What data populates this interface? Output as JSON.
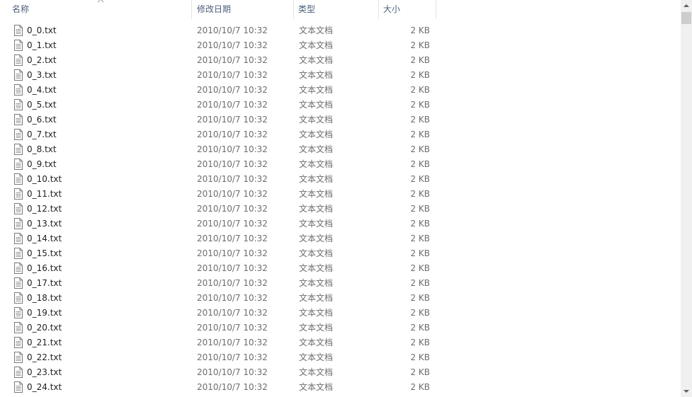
{
  "columns": {
    "name": "名称",
    "date_modified": "修改日期",
    "type": "类型",
    "size": "大小"
  },
  "sort": {
    "column": "name",
    "direction": "ascending",
    "icon": "sort-up-icon"
  },
  "files": [
    {
      "name": "0_0.txt",
      "date": "2010/10/7 10:32",
      "type": "文本文档",
      "size": "2 KB"
    },
    {
      "name": "0_1.txt",
      "date": "2010/10/7 10:32",
      "type": "文本文档",
      "size": "2 KB"
    },
    {
      "name": "0_2.txt",
      "date": "2010/10/7 10:32",
      "type": "文本文档",
      "size": "2 KB"
    },
    {
      "name": "0_3.txt",
      "date": "2010/10/7 10:32",
      "type": "文本文档",
      "size": "2 KB"
    },
    {
      "name": "0_4.txt",
      "date": "2010/10/7 10:32",
      "type": "文本文档",
      "size": "2 KB"
    },
    {
      "name": "0_5.txt",
      "date": "2010/10/7 10:32",
      "type": "文本文档",
      "size": "2 KB"
    },
    {
      "name": "0_6.txt",
      "date": "2010/10/7 10:32",
      "type": "文本文档",
      "size": "2 KB"
    },
    {
      "name": "0_7.txt",
      "date": "2010/10/7 10:32",
      "type": "文本文档",
      "size": "2 KB"
    },
    {
      "name": "0_8.txt",
      "date": "2010/10/7 10:32",
      "type": "文本文档",
      "size": "2 KB"
    },
    {
      "name": "0_9.txt",
      "date": "2010/10/7 10:32",
      "type": "文本文档",
      "size": "2 KB"
    },
    {
      "name": "0_10.txt",
      "date": "2010/10/7 10:32",
      "type": "文本文档",
      "size": "2 KB"
    },
    {
      "name": "0_11.txt",
      "date": "2010/10/7 10:32",
      "type": "文本文档",
      "size": "2 KB"
    },
    {
      "name": "0_12.txt",
      "date": "2010/10/7 10:32",
      "type": "文本文档",
      "size": "2 KB"
    },
    {
      "name": "0_13.txt",
      "date": "2010/10/7 10:32",
      "type": "文本文档",
      "size": "2 KB"
    },
    {
      "name": "0_14.txt",
      "date": "2010/10/7 10:32",
      "type": "文本文档",
      "size": "2 KB"
    },
    {
      "name": "0_15.txt",
      "date": "2010/10/7 10:32",
      "type": "文本文档",
      "size": "2 KB"
    },
    {
      "name": "0_16.txt",
      "date": "2010/10/7 10:32",
      "type": "文本文档",
      "size": "2 KB"
    },
    {
      "name": "0_17.txt",
      "date": "2010/10/7 10:32",
      "type": "文本文档",
      "size": "2 KB"
    },
    {
      "name": "0_18.txt",
      "date": "2010/10/7 10:32",
      "type": "文本文档",
      "size": "2 KB"
    },
    {
      "name": "0_19.txt",
      "date": "2010/10/7 10:32",
      "type": "文本文档",
      "size": "2 KB"
    },
    {
      "name": "0_20.txt",
      "date": "2010/10/7 10:32",
      "type": "文本文档",
      "size": "2 KB"
    },
    {
      "name": "0_21.txt",
      "date": "2010/10/7 10:32",
      "type": "文本文档",
      "size": "2 KB"
    },
    {
      "name": "0_22.txt",
      "date": "2010/10/7 10:32",
      "type": "文本文档",
      "size": "2 KB"
    },
    {
      "name": "0_23.txt",
      "date": "2010/10/7 10:32",
      "type": "文本文档",
      "size": "2 KB"
    },
    {
      "name": "0_24.txt",
      "date": "2010/10/7 10:32",
      "type": "文本文档",
      "size": "2 KB"
    }
  ],
  "file_icon": "text-document-icon",
  "colors": {
    "header_text": "#4c607a",
    "name_text": "#1e1e1e",
    "meta_text": "#6d6d6d",
    "scrollbar_track": "#f0f0f0",
    "scrollbar_thumb": "#cdcdcd"
  }
}
